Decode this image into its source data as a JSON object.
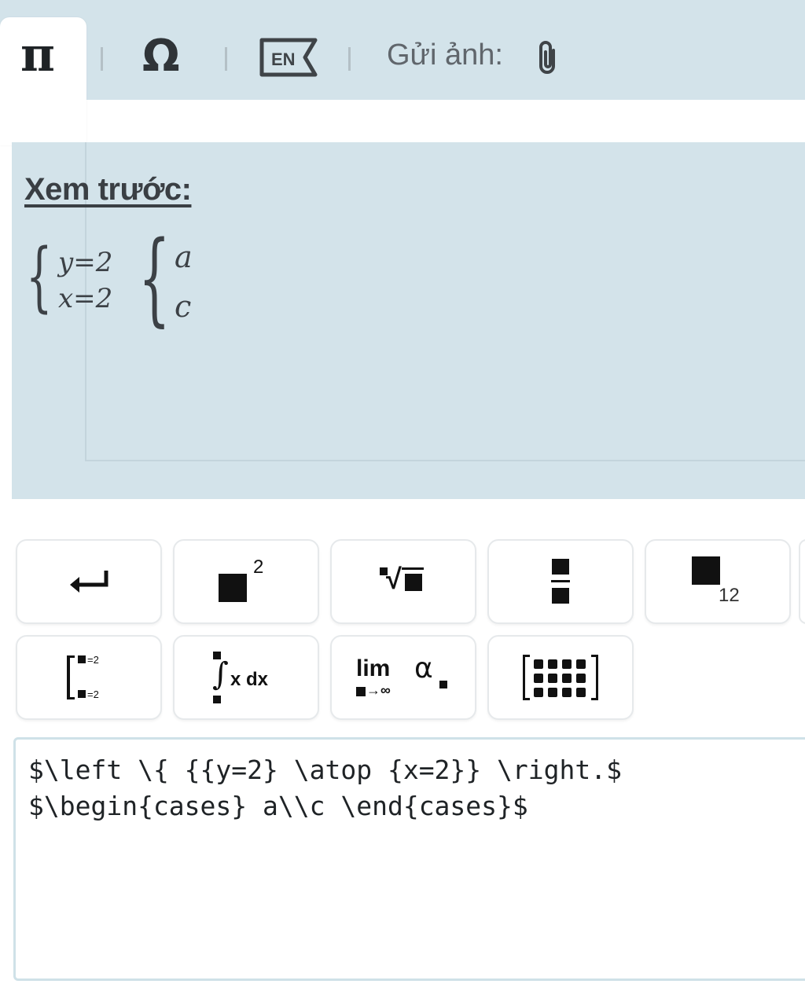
{
  "toolbar": {
    "tabs": [
      {
        "name": "pi-icon",
        "glyph": "π"
      },
      {
        "name": "omega-icon",
        "glyph": "Ω"
      },
      {
        "name": "en-keyboard-icon",
        "glyph": "EN"
      }
    ],
    "send_image_label": "Gửi ảnh:",
    "attach_icon": "paperclip-icon"
  },
  "preview": {
    "title": "Xem trước:",
    "system1": [
      "y=2",
      "x=2"
    ],
    "system2": [
      "a",
      "c"
    ]
  },
  "buttons": [
    {
      "name": "newline-button",
      "icon": "return-arrow-icon"
    },
    {
      "name": "superscript-button",
      "icon": "power-icon",
      "exponent": "2"
    },
    {
      "name": "nth-root-button",
      "icon": "root-icon",
      "radical": "√"
    },
    {
      "name": "fraction-button",
      "icon": "fraction-icon"
    },
    {
      "name": "subscript-button",
      "icon": "subscript-icon",
      "subscript": "12"
    },
    {
      "name": "system-button",
      "icon": "system-brace-icon",
      "row1": "=2",
      "row2": "=2"
    },
    {
      "name": "integral-button",
      "icon": "integral-icon",
      "label": "x dx"
    },
    {
      "name": "limit-button",
      "icon": "limit-icon",
      "lim": "lim",
      "arrow": "→∞",
      "alpha": "α"
    },
    {
      "name": "matrix-button",
      "icon": "matrix-icon"
    }
  ],
  "editor": {
    "lines": [
      "$\\left \\{ {{y=2} \\atop {x=2}} \\right.$",
      "$\\begin{cases} a\\\\c \\end{cases}$"
    ]
  },
  "colors": {
    "panel_bg": "#d3e3ea",
    "text_dark": "#1f2326",
    "border": "#cfe1e8"
  }
}
